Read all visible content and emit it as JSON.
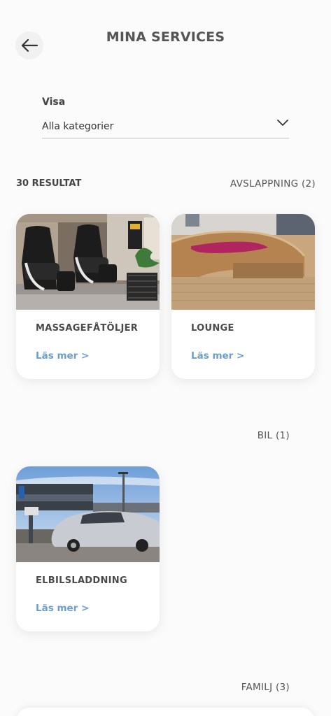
{
  "header": {
    "title": "MINA SERVICES",
    "back_icon": "arrow-left-icon"
  },
  "filter": {
    "label": "Visa",
    "value": "Alla kategorier",
    "chevron_icon": "chevron-down-icon"
  },
  "results": {
    "count_label": "30 RESULTAT"
  },
  "sections": [
    {
      "label": "AVSLAPPNING (2)",
      "cards": [
        {
          "title": "MASSAGEFÅTÖLJER",
          "link": "Läs mer >"
        },
        {
          "title": "LOUNGE",
          "link": "Läs mer >"
        }
      ]
    },
    {
      "label": "BIL (1)",
      "cards": [
        {
          "title": "ELBILSLADDNING",
          "link": "Läs mer >"
        }
      ]
    },
    {
      "label": "FAMILJ (3)",
      "cards": []
    }
  ],
  "colors": {
    "accent_link": "#6a9ed0",
    "text_dark": "#4a4a4a",
    "background": "#fbfbfb"
  }
}
